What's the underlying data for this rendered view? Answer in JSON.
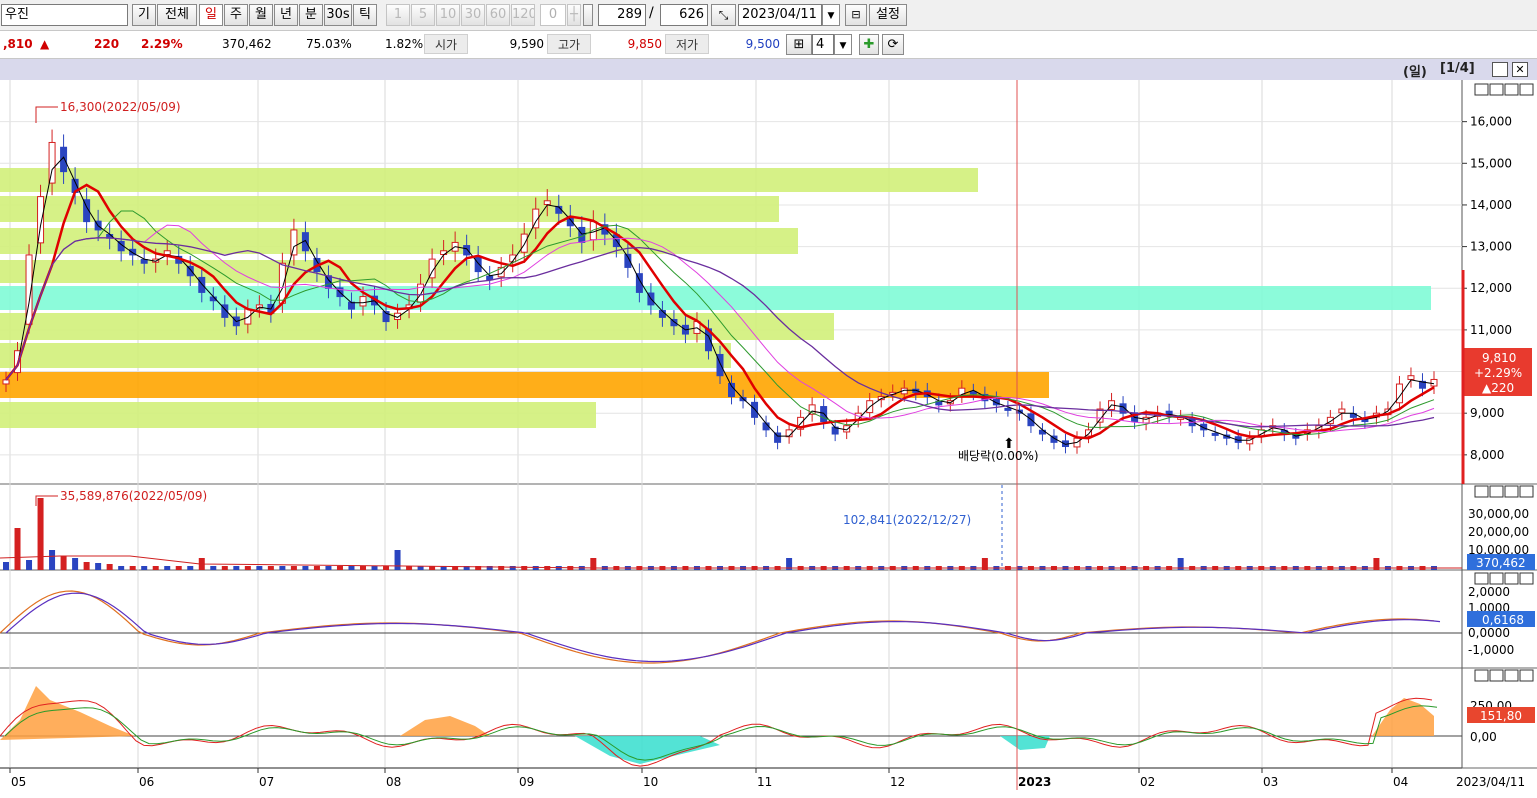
{
  "toolbar": {
    "stock_name": "우진",
    "buttons": {
      "gi": "기",
      "all": "전체",
      "day": "일",
      "week": "주",
      "month": "월",
      "year": "년",
      "minute": "분",
      "sec30": "30s",
      "tick": "틱"
    },
    "intervals": [
      "1",
      "5",
      "10",
      "30",
      "60",
      "120"
    ],
    "zero_value": "0",
    "count_current": "289",
    "slash": "/",
    "count_total": "626",
    "date": "2023/04/11",
    "settings": "설정"
  },
  "quote": {
    "price": ",810",
    "change_arrow": "▲",
    "change": "220",
    "change_pct": "2.29%",
    "volume": "370,462",
    "vol_ratio": "75.03%",
    "turnover": "1.82%",
    "open_label": "시가",
    "open": "9,590",
    "high_label": "고가",
    "high": "9,850",
    "low_label": "저가",
    "low": "9,500",
    "grid_count": "4"
  },
  "chart_header": {
    "period": "(일)",
    "page": "[1/4]"
  },
  "colors": {
    "up": "#d42020",
    "down": "#2a44c0",
    "lime": "#d2f07a",
    "cyan": "#7ffbd6",
    "orange": "#ffa500",
    "ma5": "#000000",
    "ma20": "#e00000",
    "ma60": "#2e9a2e",
    "ma120": "#e040e0",
    "ma240": "#6a2e9e",
    "macd": "#e07020",
    "signal": "#5a30c0"
  },
  "chart_data": [
    {
      "type": "candlestick",
      "x_months": [
        "05",
        "06",
        "07",
        "08",
        "09",
        "10",
        "11",
        "12",
        "2023",
        "02",
        "03",
        "04"
      ],
      "last_date": "2023/04/11",
      "y_ticks": [
        "16,000",
        "15,000",
        "14,000",
        "13,000",
        "12,000",
        "11,000",
        "10,000",
        "9,000",
        "8,000"
      ],
      "ylim": [
        7300,
        17000
      ],
      "annotations": {
        "max": "16,300(2022/05/09)",
        "dividend": "배당락(0.00%)"
      },
      "current_label": {
        "price": "9,810",
        "pct": "+2.29%",
        "change": "▲220"
      },
      "closes": [
        9800,
        10500,
        12800,
        14200,
        15500,
        14800,
        14300,
        13600,
        13400,
        13200,
        12900,
        12800,
        12600,
        12700,
        12900,
        12600,
        12300,
        11900,
        11700,
        11300,
        11100,
        11500,
        11600,
        11400,
        12600,
        13400,
        12900,
        12400,
        12000,
        11800,
        11500,
        11800,
        11600,
        11200,
        11400,
        11600,
        12100,
        12700,
        12900,
        13100,
        12800,
        12400,
        12200,
        12500,
        12800,
        13300,
        13900,
        14100,
        13800,
        13500,
        13100,
        13600,
        13300,
        13000,
        12500,
        11900,
        11600,
        11300,
        11100,
        10900,
        11200,
        10500,
        9900,
        9400,
        9300,
        8900,
        8600,
        8300,
        8600,
        8900,
        9200,
        8800,
        8500,
        8700,
        9000,
        9300,
        9400,
        9500,
        9600,
        9500,
        9400,
        9200,
        9300,
        9600,
        9500,
        9300,
        9200,
        9100,
        9000,
        8700,
        8500,
        8300,
        8200,
        8400,
        8600,
        9100,
        9300,
        9000,
        8800,
        8900,
        9000,
        8950,
        8900,
        8700,
        8600,
        8500,
        8400,
        8300,
        8400,
        8600,
        8700,
        8500,
        8400,
        8600,
        8700,
        8900,
        9100,
        8900,
        8800,
        9000,
        9100,
        9700,
        9900,
        9600,
        9810
      ],
      "volume_max": "35,589,876(2022/05/09)",
      "volume_note": "102,841(2022/12/27)",
      "volume_ticks": [
        "30,000,00",
        "20,000,00",
        "10,000,00"
      ],
      "volume_current": "370,462",
      "macd_ticks": [
        "2,0000",
        "1,0000",
        "0,0000",
        "-1,0000"
      ],
      "macd_current": "0,6168",
      "osc_ticks": [
        "250,00",
        "0,00"
      ],
      "osc_current": "151,80"
    }
  ]
}
